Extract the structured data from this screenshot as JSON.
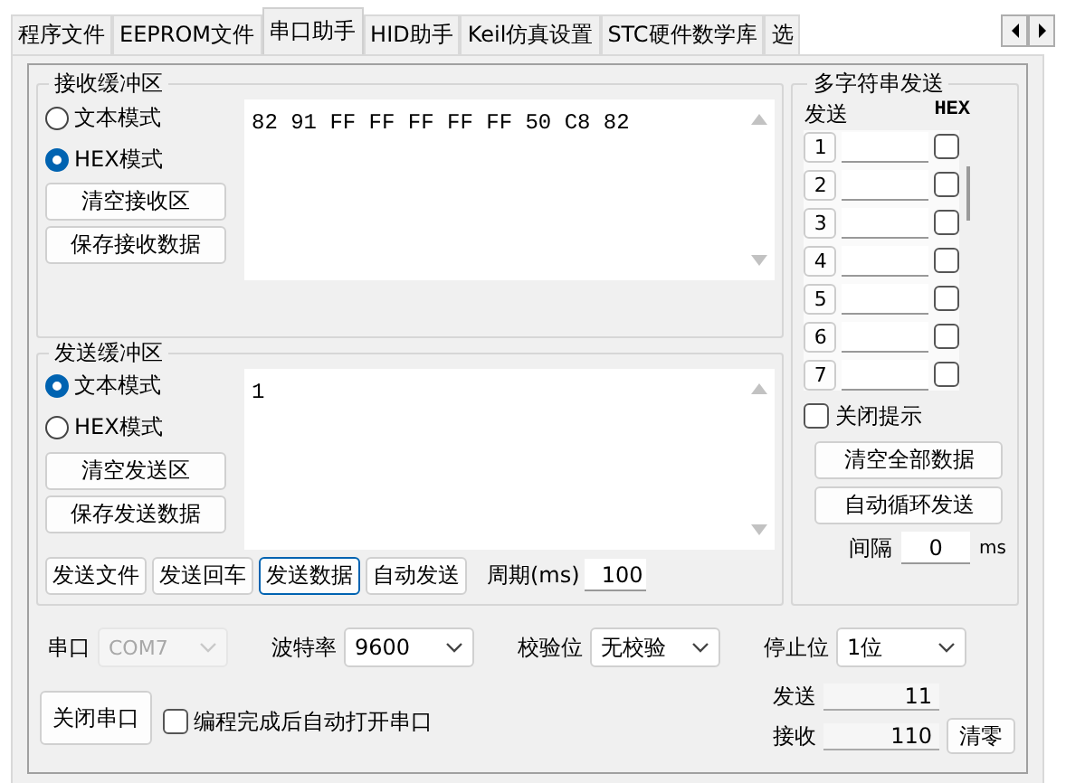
{
  "tabs": [
    {
      "label": "程序文件",
      "selected": false
    },
    {
      "label": "EEPROM文件",
      "selected": false
    },
    {
      "label": "串口助手",
      "selected": true
    },
    {
      "label": "HID助手",
      "selected": false
    },
    {
      "label": "Keil仿真设置",
      "selected": false
    },
    {
      "label": "STC硬件数学库",
      "selected": false
    },
    {
      "label": "选",
      "selected": false
    }
  ],
  "receive_buffer": {
    "title": "接收缓冲区",
    "modes": [
      {
        "label": "文本模式",
        "selected": false
      },
      {
        "label": "HEX模式",
        "selected": true
      }
    ],
    "buttons": [
      "清空接收区",
      "保存接收数据"
    ],
    "content": "82 91 FF FF FF FF FF 50 C8 82"
  },
  "send_buffer": {
    "title": "发送缓冲区",
    "modes": [
      {
        "label": "文本模式",
        "selected": true
      },
      {
        "label": "HEX模式",
        "selected": false
      }
    ],
    "buttons": [
      "清空发送区",
      "保存发送数据"
    ],
    "content": "1",
    "actions": [
      {
        "label": "发送文件",
        "focused": false
      },
      {
        "label": "发送回车",
        "focused": false
      },
      {
        "label": "发送数据",
        "focused": true
      },
      {
        "label": "自动发送",
        "focused": false
      }
    ],
    "period_label": "周期(ms)",
    "period_value": "100"
  },
  "multi_send": {
    "title": "多字符串发送",
    "send_header": "发送",
    "hex_header": "HEX",
    "rows": [
      {
        "number": "1",
        "hex": false
      },
      {
        "number": "2",
        "hex": false
      },
      {
        "number": "3",
        "hex": false
      },
      {
        "number": "4",
        "hex": false
      },
      {
        "number": "5",
        "hex": false
      },
      {
        "number": "6",
        "hex": false
      },
      {
        "number": "7",
        "hex": false
      }
    ],
    "close_tips": {
      "label": "关闭提示",
      "checked": false
    },
    "buttons": [
      "清空全部数据",
      "自动循环发送"
    ],
    "interval_label": "间隔",
    "interval_value": "0",
    "interval_unit": "ms"
  },
  "settings": [
    {
      "label": "串口",
      "value": "COM7",
      "disabled": true
    },
    {
      "label": "波特率",
      "value": "9600",
      "disabled": false
    },
    {
      "label": "校验位",
      "value": "无校验",
      "disabled": false
    },
    {
      "label": "停止位",
      "value": "1位",
      "disabled": false
    }
  ],
  "open_button": "关闭串口",
  "auto_open": {
    "label": "编程完成后自动打开串口",
    "checked": false
  },
  "counters": [
    {
      "label": "发送",
      "value": "11"
    },
    {
      "label": "接收",
      "value": "110"
    }
  ],
  "clear_button": "清零"
}
